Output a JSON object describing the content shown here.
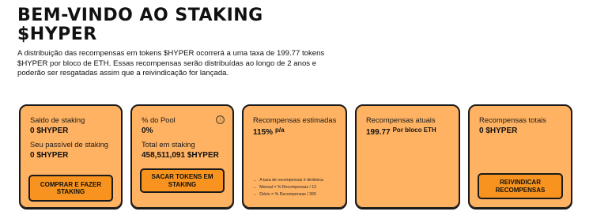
{
  "header": {
    "title_line1": "BEM-VINDO AO STAKING",
    "title_line2": "$HYPER",
    "description": "A distribuição das recompensas em tokens $HYPER ocorrerá a uma taxa de 199.77 tokens $HYPER por bloco de ETH. Essas recompensas serão distribuídas ao longo de 2 anos e poderão ser resgatadas assim que a reivindicação for lançada."
  },
  "cards": {
    "staking_balance": {
      "label": "Saldo de staking",
      "value": "0 $HYPER",
      "stakeable_label": "Seu passível de staking",
      "stakeable_value": "0 $HYPER",
      "button_label": "COMPRAR E FAZER STAKING"
    },
    "pool": {
      "label": "% do Pool",
      "info_icon": "ⓘ",
      "value": "0%",
      "total_label": "Total em staking",
      "total_value": "458,511,091 $HYPER",
      "button_label": "SACAR TOKENS EM STAKING"
    },
    "estimated": {
      "label": "Recompensas estimadas",
      "value": "115%",
      "unit": "p/a",
      "notes": [
        "A taxa de recompensas é dinâmica",
        "Mensal = % Recompensas / 12",
        "Diário = % Recompensas / 365"
      ],
      "note_arrow": "←"
    },
    "current": {
      "label": "Recompensas atuais",
      "value": "199.77",
      "unit": "Por bloco ETH"
    },
    "total": {
      "label": "Recompensas totais",
      "value": "0 $HYPER",
      "button_label": "REIVINDICAR RECOMPENSAS"
    }
  },
  "colors": {
    "card_bg": "#ffb262",
    "button_bg": "#f7931e",
    "border": "#1a1a1a"
  }
}
